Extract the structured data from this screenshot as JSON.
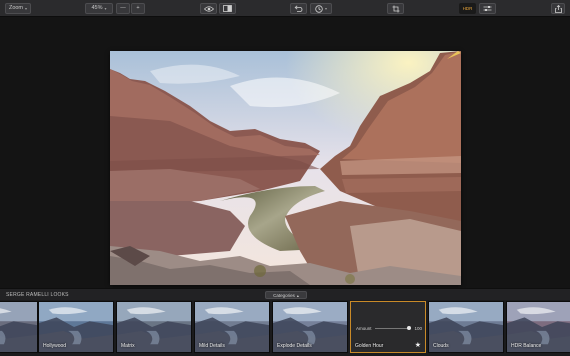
{
  "toolbar": {
    "zoom_label": "Zoom",
    "zoom_level": "45%",
    "minus_label": "—",
    "plus_label": "+",
    "active_badge": "HDR"
  },
  "looks": {
    "section_title": "SERGE RAMELLI LOOKS",
    "categories_label": "Categories",
    "items": [
      {
        "label": ""
      },
      {
        "label": "Hollywood"
      },
      {
        "label": "Matrix"
      },
      {
        "label": "Mild Details"
      },
      {
        "label": "Explode Details"
      },
      {
        "label": "Golden Hour",
        "amount_label": "Amount",
        "amount_value": "100"
      },
      {
        "label": "Clouds"
      },
      {
        "label": "HDR Balance"
      },
      {
        "label": ""
      }
    ]
  },
  "colors": {
    "accent": "#e9a63a",
    "selected_border": "#c98a28"
  }
}
